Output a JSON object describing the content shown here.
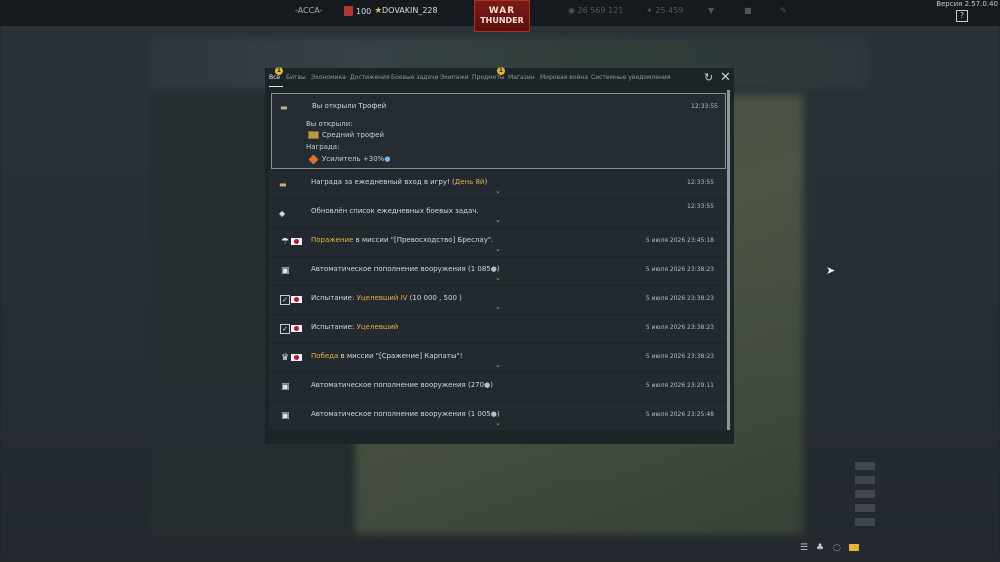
{
  "topbar": {
    "squadron": "-ACCA-",
    "rank": "100",
    "username": "DOVAKIN_228",
    "lions": "26 569 121",
    "eagles": "25 459",
    "version": "Версия 2.57.0.40",
    "help": "?"
  },
  "logo": {
    "line1": "WAR",
    "line2": "THUNDER"
  },
  "tabs": [
    {
      "label": "Все",
      "badge": "1"
    },
    {
      "label": "Битвы",
      "badge": ""
    },
    {
      "label": "Экономика",
      "badge": ""
    },
    {
      "label": "Достижения",
      "badge": ""
    },
    {
      "label": "Боевые задачи",
      "badge": ""
    },
    {
      "label": "Экипажи",
      "badge": ""
    },
    {
      "label": "Предметы",
      "badge": "1"
    },
    {
      "label": "Магазин",
      "badge": ""
    },
    {
      "label": "Мировая война",
      "badge": ""
    },
    {
      "label": "Системные уведомления",
      "badge": ""
    }
  ],
  "expanded": {
    "title": "Вы открыли Трофей",
    "time": "12:33:55",
    "opened_label": "Вы открыли:",
    "opened_item": "Средний трофей",
    "reward_label": "Награда:",
    "reward_item": "Усилитель +30%"
  },
  "notifications": [
    {
      "pre": "Награда за ежедневный вход в игру! (",
      "hl": "День 8й",
      "post": ")",
      "time": "12:33:55"
    },
    {
      "pre": "Обновлён список ежедневных боевых задач.",
      "hl": "",
      "post": "",
      "time": "12:33:55"
    },
    {
      "pre": "",
      "hl": "Поражение",
      "post": " в миссии \"[Превосходство] Бреслау\".",
      "time": "5 июля 2026 23:45:18"
    },
    {
      "pre": "Автоматическое пополнение вооружения (1 085",
      "hl": "",
      "post": ")",
      "time": "5 июля 2026 23:38:23"
    },
    {
      "pre": "Испытание: ",
      "hl": "Уцелевший IV",
      "post": " (10 000 , 500 )",
      "time": "5 июля 2026 23:38:23"
    },
    {
      "pre": "Испытание: ",
      "hl": "Уцелевший",
      "post": "",
      "time": "5 июля 2026 23:38:23"
    },
    {
      "pre": "",
      "hl": "Победа",
      "post": " в миссии \"[Сражение] Карпаты\"!",
      "time": "5 июля 2026 23:38:23"
    },
    {
      "pre": "Автоматическое пополнение вооружения (270",
      "hl": "",
      "post": ")",
      "time": "5 июля 2026 23:29:11"
    },
    {
      "pre": "Автоматическое пополнение вооружения (1 005",
      "hl": "",
      "post": ")",
      "time": "5 июля 2026 23:25:48"
    }
  ],
  "colors": {
    "accent": "#e8b040",
    "panel": "#1d2428",
    "row": "#232a2f"
  }
}
